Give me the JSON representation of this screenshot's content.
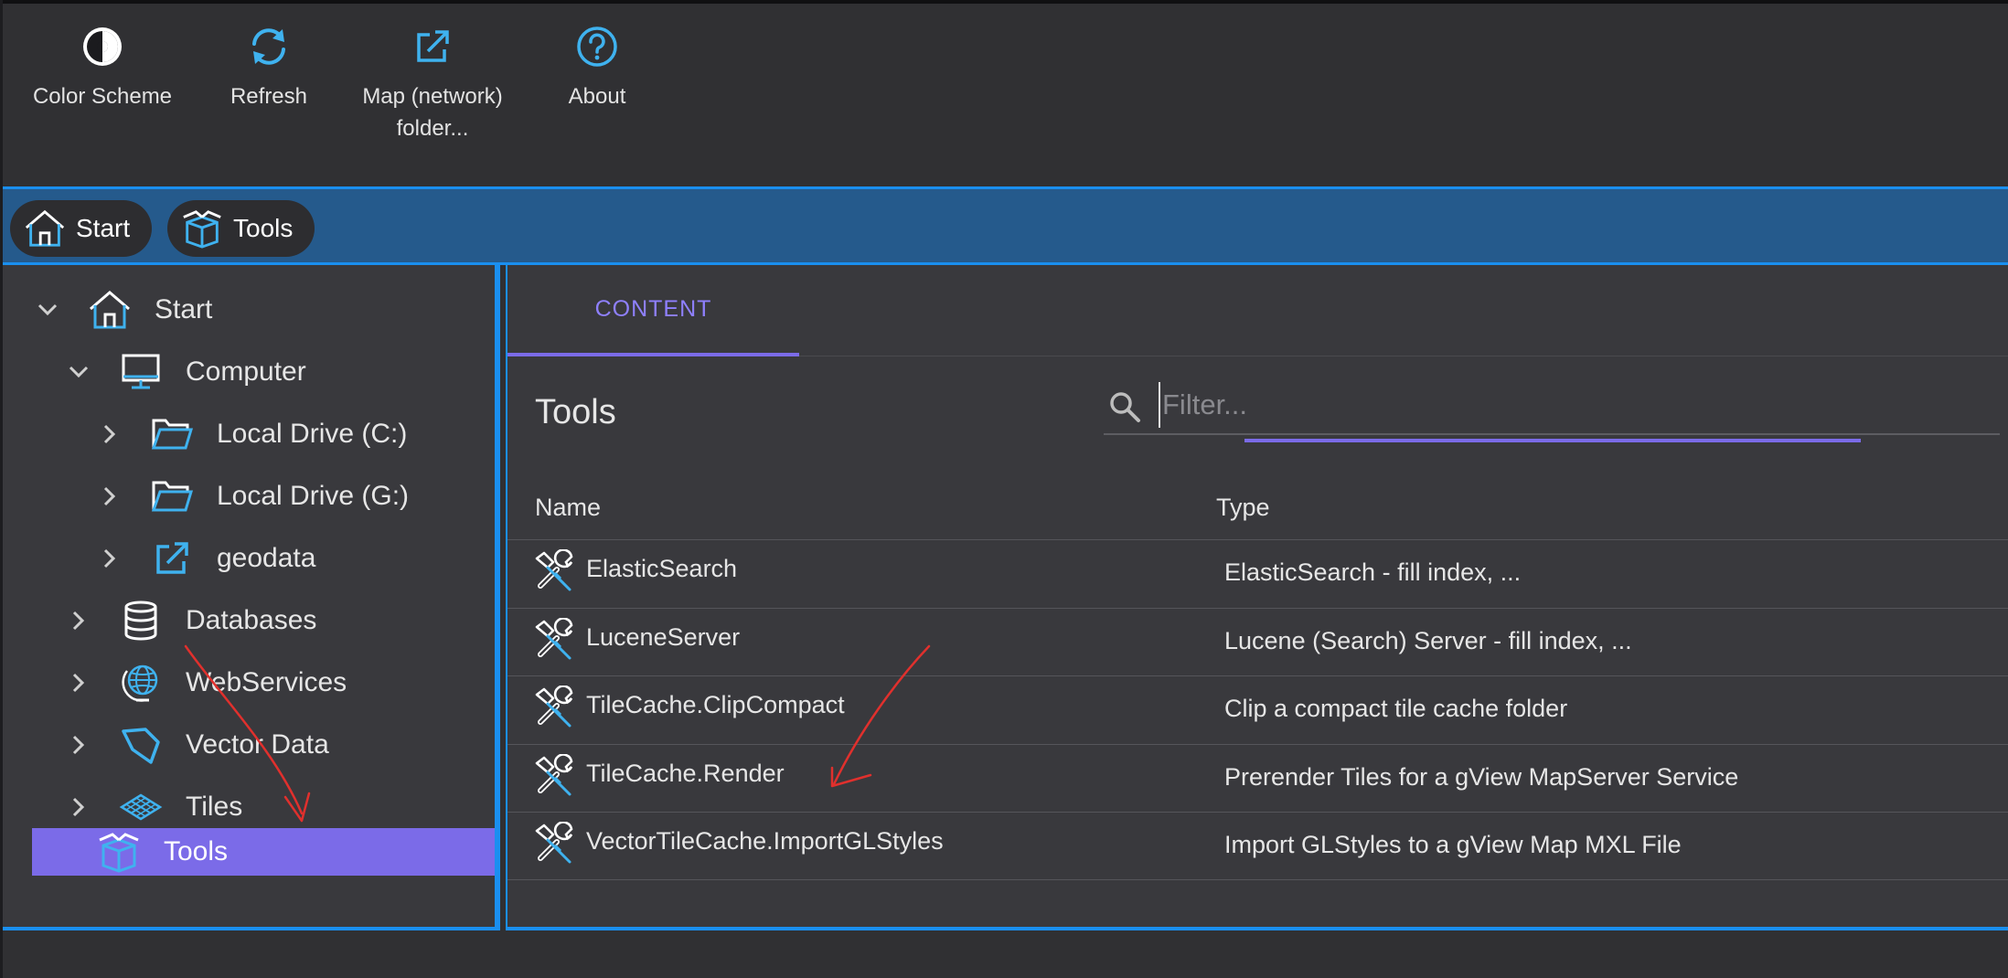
{
  "toolbar": {
    "buttons": [
      {
        "label": "Color Scheme",
        "icon": "contrast-icon"
      },
      {
        "label": "Refresh",
        "icon": "refresh-icon"
      },
      {
        "label": "Map (network)\nfolder...",
        "icon": "open-external-icon"
      },
      {
        "label": "About",
        "icon": "help-icon"
      }
    ]
  },
  "breadcrumb": [
    {
      "label": "Start",
      "icon": "home-icon"
    },
    {
      "label": "Tools",
      "icon": "box-icon"
    }
  ],
  "tree": [
    {
      "label": "Start",
      "icon": "home-icon",
      "expanded": true
    },
    {
      "label": "Computer",
      "icon": "monitor-icon",
      "expanded": true
    },
    {
      "label": "Local Drive (C:)",
      "icon": "folder-icon",
      "expanded": false
    },
    {
      "label": "Local Drive (G:)",
      "icon": "folder-icon",
      "expanded": false
    },
    {
      "label": "geodata",
      "icon": "open-external-icon",
      "expanded": false
    },
    {
      "label": "Databases",
      "icon": "database-icon",
      "expanded": false
    },
    {
      "label": "WebServices",
      "icon": "globe-icon",
      "expanded": false
    },
    {
      "label": "Vector Data",
      "icon": "polygon-icon",
      "expanded": false
    },
    {
      "label": "Tiles",
      "icon": "tiles-icon",
      "expanded": false
    },
    {
      "label": "Tools",
      "icon": "box-icon",
      "selected": true
    }
  ],
  "content": {
    "tab": "CONTENT",
    "title": "Tools",
    "filter": {
      "placeholder": "Filter...",
      "value": ""
    },
    "columns": {
      "name": "Name",
      "type": "Type"
    },
    "rows": [
      {
        "name": "ElasticSearch",
        "type": "ElasticSearch - fill index, ...",
        "icon": "tools-icon"
      },
      {
        "name": "LuceneServer",
        "type": "Lucene (Search) Server - fill index, ...",
        "icon": "tools-icon"
      },
      {
        "name": "TileCache.ClipCompact",
        "type": "Clip a compact tile cache folder",
        "icon": "tools-icon"
      },
      {
        "name": "TileCache.Render",
        "type": "Prerender Tiles for a gView MapServer Service",
        "icon": "tools-icon"
      },
      {
        "name": "VectorTileCache.ImportGLStyles",
        "type": "Import GLStyles to a gView Map MXL File",
        "icon": "tools-icon"
      }
    ]
  },
  "colors": {
    "accent": "#7b6be8",
    "blue": "#1a8ff0",
    "icon": "#3fb2ef",
    "annotation": "#e0302d"
  }
}
